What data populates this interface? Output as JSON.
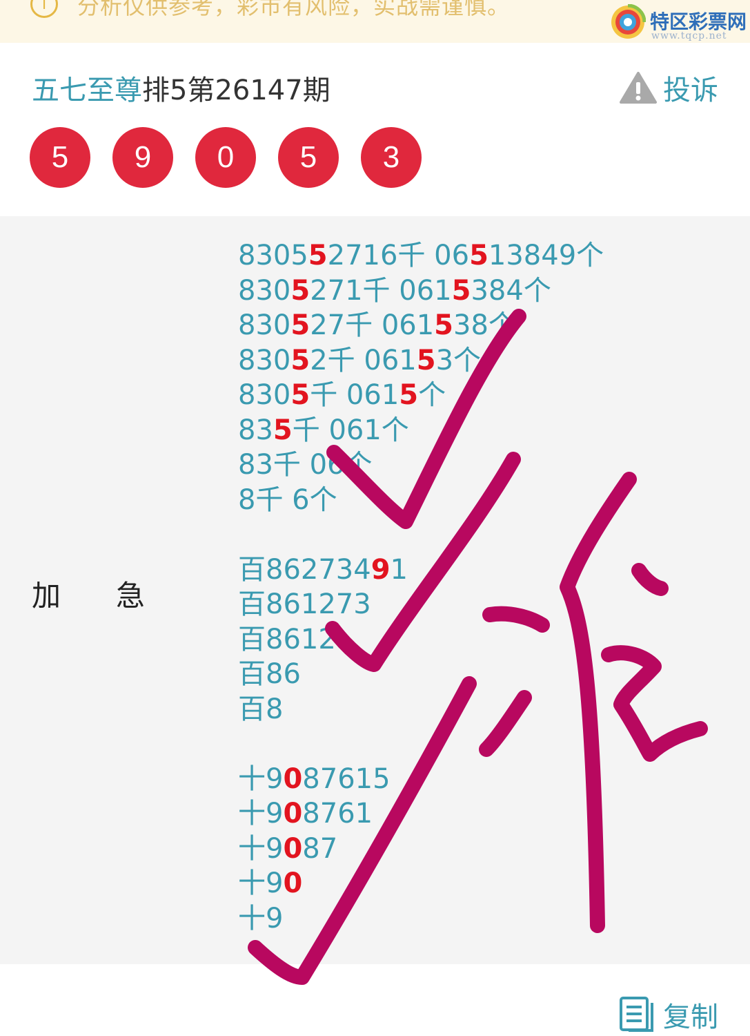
{
  "notice": {
    "text": "分析仅供参考，彩市有风险，实战需谨慎。"
  },
  "watermark": {
    "name": "特区彩票网",
    "url": "www.tqcp.net"
  },
  "header": {
    "author": "五七至尊",
    "issue_title": "排5第26147期",
    "complain_label": "投诉"
  },
  "draw": {
    "numbers": [
      "5",
      "9",
      "0",
      "5",
      "3"
    ]
  },
  "prediction": {
    "label": "加急",
    "groups": [
      [
        [
          {
            "t": "8305"
          },
          {
            "t": "5",
            "hit": true
          },
          {
            "t": "2716千 06"
          },
          {
            "t": "5",
            "hit": true
          },
          {
            "t": "13849个"
          }
        ],
        [
          {
            "t": "830"
          },
          {
            "t": "5",
            "hit": true
          },
          {
            "t": "271千 061"
          },
          {
            "t": "5",
            "hit": true
          },
          {
            "t": "384个"
          }
        ],
        [
          {
            "t": "830"
          },
          {
            "t": "5",
            "hit": true
          },
          {
            "t": "27千 061"
          },
          {
            "t": "5",
            "hit": true
          },
          {
            "t": "38个"
          }
        ],
        [
          {
            "t": "830"
          },
          {
            "t": "5",
            "hit": true
          },
          {
            "t": "2千 061"
          },
          {
            "t": "5",
            "hit": true
          },
          {
            "t": "3个"
          }
        ],
        [
          {
            "t": "830"
          },
          {
            "t": "5",
            "hit": true
          },
          {
            "t": "千 061"
          },
          {
            "t": "5",
            "hit": true
          },
          {
            "t": "个"
          }
        ],
        [
          {
            "t": "83"
          },
          {
            "t": "5",
            "hit": true
          },
          {
            "t": "千 061个"
          }
        ],
        [
          {
            "t": "83千 06个"
          }
        ],
        [
          {
            "t": "8千 6个"
          }
        ]
      ],
      [
        [
          {
            "t": "百862734"
          },
          {
            "t": "9",
            "hit": true
          },
          {
            "t": "1"
          }
        ],
        [
          {
            "t": "百861273"
          }
        ],
        [
          {
            "t": "百8612"
          }
        ],
        [
          {
            "t": "百86"
          }
        ],
        [
          {
            "t": "百8"
          }
        ]
      ],
      [
        [
          {
            "t": "十9"
          },
          {
            "t": "0",
            "hit": true
          },
          {
            "t": "87615"
          }
        ],
        [
          {
            "t": "十9"
          },
          {
            "t": "0",
            "hit": true
          },
          {
            "t": "8761"
          }
        ],
        [
          {
            "t": "十9"
          },
          {
            "t": "0",
            "hit": true
          },
          {
            "t": "87"
          }
        ],
        [
          {
            "t": "十9"
          },
          {
            "t": "0",
            "hit": true
          }
        ],
        [
          {
            "t": "十9"
          }
        ]
      ]
    ]
  },
  "footer": {
    "copy_label": "复制"
  },
  "colors": {
    "accent": "#3a9ab0",
    "ball": "#e0283d",
    "hit": "#e2141f",
    "scribble": "#b8085f",
    "notice_bg": "#fdf7e6"
  }
}
